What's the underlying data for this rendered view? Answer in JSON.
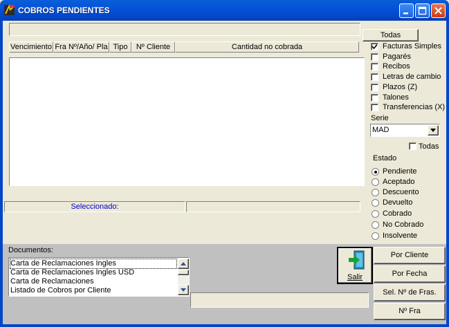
{
  "window": {
    "title": "COBROS PENDIENTES"
  },
  "columns": [
    "Vencimiento",
    "Fra Nº/Año/ Pla",
    "Tipo",
    "Nº Cliente",
    "Cantidad no cobrada"
  ],
  "selected_label": "Seleccionado:",
  "filters": {
    "todas_button": "Todas",
    "types": [
      {
        "label": "Facturas Simples",
        "checked": true
      },
      {
        "label": "Pagarés",
        "checked": false
      },
      {
        "label": "Recibos",
        "checked": false
      },
      {
        "label": "Letras de cambio",
        "checked": false
      },
      {
        "label": "Plazos (Z)",
        "checked": false
      },
      {
        "label": "Talones",
        "checked": false
      },
      {
        "label": "Transferencias (X)",
        "checked": false
      }
    ],
    "serie_label": "Serie",
    "serie_value": "MAD",
    "todas_check_label": "Todas",
    "estado_label": "Estado",
    "estados": [
      {
        "label": "Pendiente",
        "selected": true
      },
      {
        "label": "Aceptado",
        "selected": false
      },
      {
        "label": "Descuento",
        "selected": false
      },
      {
        "label": "Devuelto",
        "selected": false
      },
      {
        "label": "Cobrado",
        "selected": false
      },
      {
        "label": "No Cobrado",
        "selected": false
      },
      {
        "label": "Insolvente",
        "selected": false
      }
    ]
  },
  "documents": {
    "label": "Documentos:",
    "items": [
      "Carta de Reclamaciones Ingles",
      "Carta de Reclamaciones Ingles USD",
      "Carta de Reclamaciones",
      "Listado de Cobros por Cliente"
    ]
  },
  "buttons": {
    "salir": "Salir",
    "por_cliente": "Por Cliente",
    "por_fecha": "Por Fecha",
    "sel_fras": "Sel. Nº de Fras.",
    "n_fra": "Nº Fra"
  }
}
